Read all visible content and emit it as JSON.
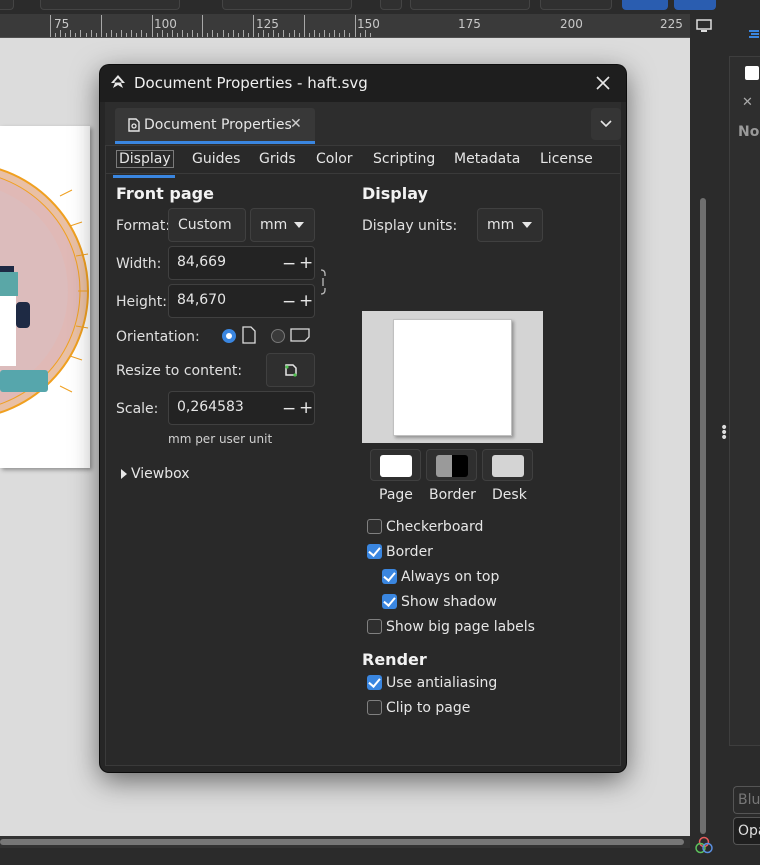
{
  "ruler": {
    "labels": [
      "75",
      "100",
      "125",
      "150",
      "175",
      "200",
      "225"
    ]
  },
  "dialog": {
    "title": "Document Properties - haft.svg",
    "dock_tab_label": "Document Properties",
    "tabs": [
      "Display",
      "Guides",
      "Grids",
      "Color",
      "Scripting",
      "Metadata",
      "License"
    ],
    "active_tab": "Display",
    "front_page": {
      "title": "Front page",
      "format_label": "Format:",
      "format_value": "Custom",
      "format_unit": "mm",
      "width_label": "Width:",
      "width_value": "84,669",
      "height_label": "Height:",
      "height_value": "84,670",
      "orientation_label": "Orientation:",
      "orientation": "portrait",
      "resize_label": "Resize to content:",
      "scale_label": "Scale:",
      "scale_value": "0,264583",
      "scale_unit_note": "mm per user unit",
      "viewbox_label": "Viewbox"
    },
    "display": {
      "title": "Display",
      "units_label": "Display units:",
      "units_value": "mm",
      "swatches": [
        {
          "label": "Page",
          "color": "#ffffff"
        },
        {
          "label": "Border",
          "color": "#000000"
        },
        {
          "label": "Desk",
          "color": "#d4d4d4"
        }
      ],
      "options": {
        "checkerboard": {
          "label": "Checkerboard",
          "checked": false
        },
        "border": {
          "label": "Border",
          "checked": true
        },
        "always_on_top": {
          "label": "Always on top",
          "checked": true
        },
        "show_shadow": {
          "label": "Show shadow",
          "checked": true
        },
        "big_page_labels": {
          "label": "Show big page labels",
          "checked": false
        }
      }
    },
    "render": {
      "title": "Render",
      "antialiasing": {
        "label": "Use antialiasing",
        "checked": true
      },
      "clip_to_page": {
        "label": "Clip to page",
        "checked": false
      }
    }
  },
  "right_panel": {
    "heading_fragment": "No",
    "blur_fragment": "Blu",
    "opacity_fragment": "Opa"
  },
  "colors": {
    "accent": "#3a86e0",
    "dialog_bg": "#292929",
    "desk": "#dcdcdc",
    "page": "#ffffff"
  }
}
